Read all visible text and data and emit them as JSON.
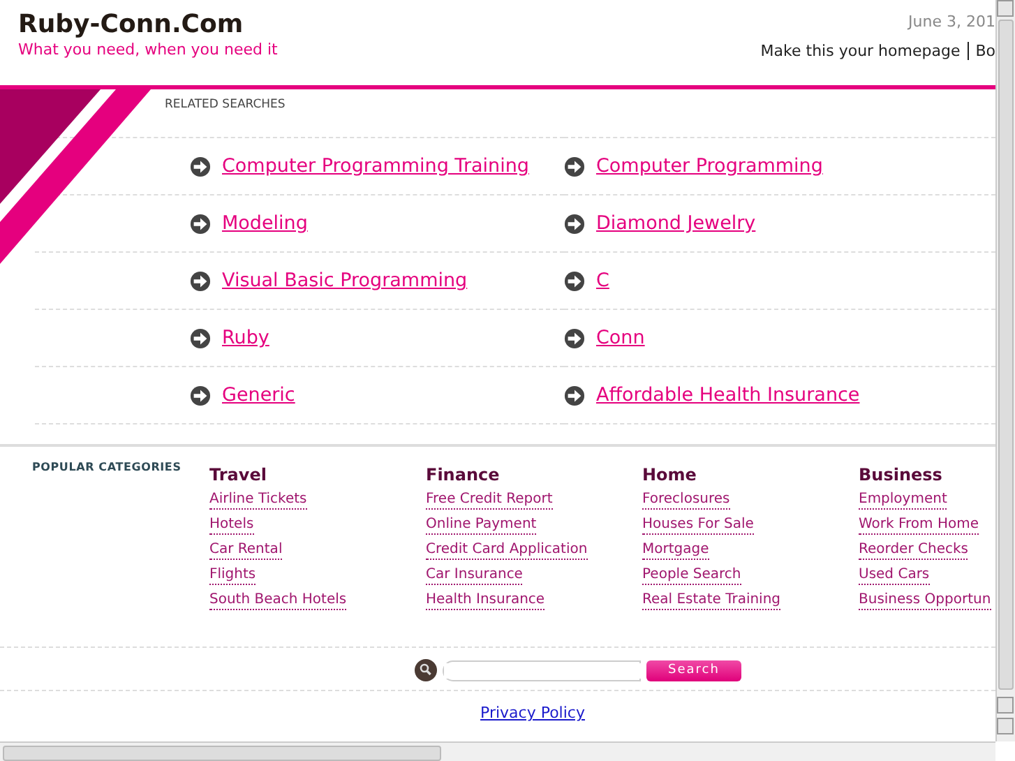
{
  "site": {
    "title": "Ruby-Conn.Com",
    "tagline": "What you need, when you need it",
    "date": "June 3, 201",
    "links": [
      "Make this your homepage",
      "Bo"
    ]
  },
  "related_searches": {
    "heading": "RELATED SEARCHES",
    "links": [
      "Computer Programming Training",
      "Computer Programming",
      "Modeling",
      "Diamond Jewelry",
      "Visual Basic Programming",
      "C",
      "Ruby",
      "Conn",
      "Generic",
      "Affordable Health Insurance"
    ]
  },
  "popular_categories": {
    "heading": "POPULAR CATEGORIES",
    "groups": [
      {
        "title": "Travel",
        "links": [
          "Airline Tickets",
          "Hotels",
          "Car Rental",
          "Flights",
          "South Beach Hotels"
        ]
      },
      {
        "title": "Finance",
        "links": [
          "Free Credit Report",
          "Online Payment",
          "Credit Card Application",
          "Car Insurance",
          "Health Insurance"
        ]
      },
      {
        "title": "Home",
        "links": [
          "Foreclosures",
          "Houses For Sale",
          "Mortgage",
          "People Search",
          "Real Estate Training"
        ]
      },
      {
        "title": "Business",
        "links": [
          "Employment",
          "Work From Home",
          "Reorder Checks",
          "Used Cars",
          "Business Opportun"
        ]
      }
    ]
  },
  "search": {
    "button": "Search"
  },
  "footer": {
    "link": "Privacy Policy"
  }
}
